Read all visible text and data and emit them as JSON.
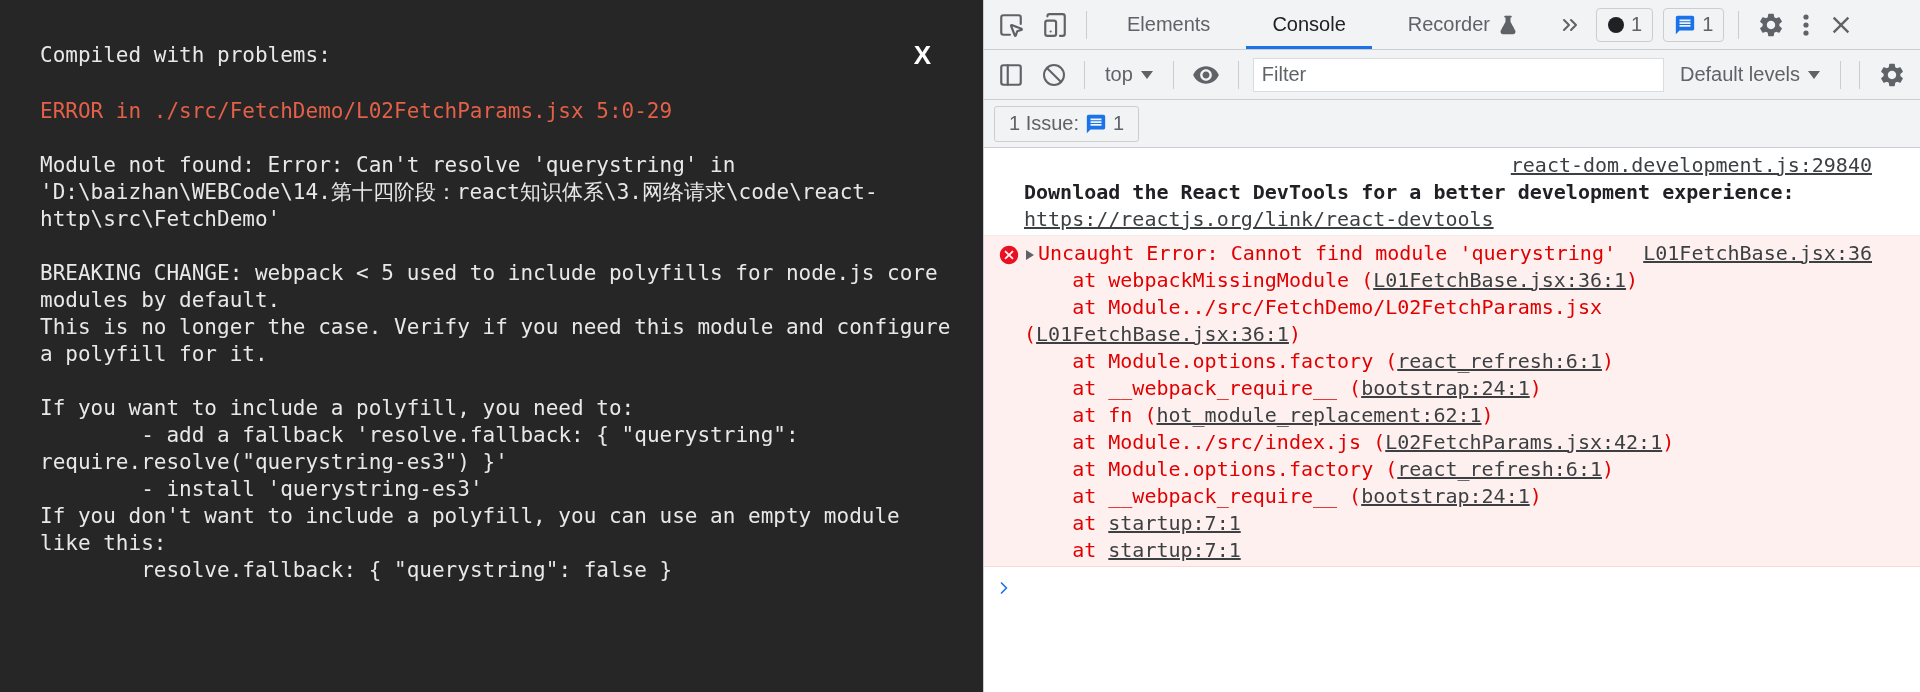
{
  "overlay": {
    "heading": "Compiled with problems:",
    "close": "X",
    "errors": [
      {
        "header": "ERROR in ./src/FetchDemo/L02FetchParams.jsx 5:0-29",
        "message": "Module not found: Error: Can't resolve 'querystring' in 'D:\\baizhan\\WEBCode\\14.第十四阶段：react知识体系\\3.网络请求\\code\\react-http\\src\\FetchDemo'\n\nBREAKING CHANGE: webpack < 5 used to include polyfills for node.js core modules by default.\nThis is no longer the case. Verify if you need this module and configure a polyfill for it.\n\nIf you want to include a polyfill, you need to:\n\t- add a fallback 'resolve.fallback: { \"querystring\": require.resolve(\"querystring-es3\") }'\n\t- install 'querystring-es3'\nIf you don't want to include a polyfill, you can use an empty module like this:\n\tresolve.fallback: { \"querystring\": false }"
      }
    ]
  },
  "devtools": {
    "tabs": [
      {
        "label": "Elements",
        "selected": false,
        "kind": "plain"
      },
      {
        "label": "Console",
        "selected": true,
        "kind": "plain"
      },
      {
        "label": "Recorder",
        "selected": false,
        "kind": "experimental"
      }
    ],
    "error_count": "1",
    "message_count": "1",
    "context": "top",
    "filter": {
      "placeholder": "Filter"
    },
    "levels": "Default levels",
    "issues": {
      "label": "1 Issue:",
      "count": "1"
    },
    "messages": [
      {
        "kind": "info",
        "source": "react-dom.development.js:29840",
        "text": "Download the React DevTools for a better development experience: ",
        "link": "https://reactjs.org/link/react-devtools"
      },
      {
        "kind": "error",
        "expanded": false,
        "source": "L01FetchBase.jsx:36",
        "text": "Uncaught Error: Cannot find module 'querystring'",
        "stack": [
          {
            "prefix": "at webpackMissingModule (",
            "link": "L01FetchBase.jsx:36:1",
            "suffix": ")"
          },
          {
            "prefix": "at Module../src/FetchDemo/L02FetchParams.jsx (",
            "link": "L01FetchBase.jsx:36:1",
            "suffix": ")"
          },
          {
            "prefix": "at Module.options.factory (",
            "link": "react_refresh:6:1",
            "suffix": ")"
          },
          {
            "prefix": "at __webpack_require__ (",
            "link": "bootstrap:24:1",
            "suffix": ")"
          },
          {
            "prefix": "at fn (",
            "link": "hot_module_replacement:62:1",
            "suffix": ")"
          },
          {
            "prefix": "at Module../src/index.js (",
            "link": "L02FetchParams.jsx:42:1",
            "suffix": ")"
          },
          {
            "prefix": "at Module.options.factory (",
            "link": "react_refresh:6:1",
            "suffix": ")"
          },
          {
            "prefix": "at __webpack_require__ (",
            "link": "bootstrap:24:1",
            "suffix": ")"
          },
          {
            "prefix": "at ",
            "link": "startup:7:1"
          },
          {
            "prefix": "at ",
            "link": "startup:7:1"
          }
        ]
      }
    ]
  }
}
